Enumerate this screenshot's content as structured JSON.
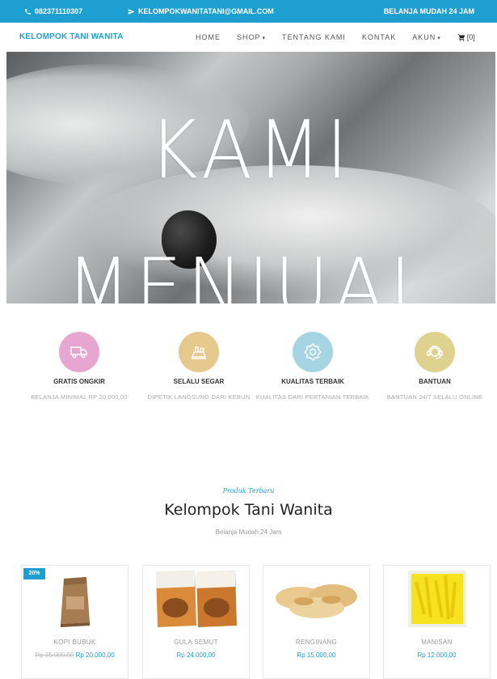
{
  "topbar": {
    "phone": "082371110307",
    "email": "KELOMPOKWANITATANI@GMAIL.COM",
    "slogan": "BELANJA MUDAH 24 JAM",
    "color": "#1e9fd2"
  },
  "navbar": {
    "brand": "KELOMPOK TANI WANITA",
    "items": [
      {
        "label": "HOME"
      },
      {
        "label": "SHOP"
      },
      {
        "label": "TENTANG KAMI"
      },
      {
        "label": "KONTAK"
      },
      {
        "label": "AKUN"
      }
    ],
    "cart_count": "[0]"
  },
  "hero": {
    "line1": "KAMI",
    "line2": "MENJUAL"
  },
  "features": [
    {
      "title": "GRATIS ONGKIR",
      "desc": "BELANJA MINIMAL RP 20.000,00",
      "color": "#e6a6cf",
      "icon": "truck-icon"
    },
    {
      "title": "SELALU SEGAR",
      "desc": "DIPETIK LANGSUNG DARI KEBUN",
      "color": "#e6c98d",
      "icon": "fresh-icon"
    },
    {
      "title": "KUALITAS TERBAIK",
      "desc": "KUALITAS DARI PERTANIAN TERBAIK",
      "color": "#a7d4e3",
      "icon": "quality-icon"
    },
    {
      "title": "BANTUAN",
      "desc": "BANTUAN 24/7 SELALU ONLINE",
      "color": "#dfd28f",
      "icon": "support-icon"
    }
  ],
  "section": {
    "kicker": "Produk Terbaru",
    "heading": "Kelompok Tani Wanita",
    "sub": "Belanja Mudah 24 Jam"
  },
  "products": [
    {
      "name": "KOPI BUBUK",
      "old_price": "Rp 35.000,00",
      "price": "Rp 20.000,00",
      "badge": "20%"
    },
    {
      "name": "GULA SEMUT",
      "price": "Rp 24.000,00"
    },
    {
      "name": "RENGINANG",
      "price": "Rp 15.000,00"
    },
    {
      "name": "MANISAN",
      "price": "Rp 12.000,00"
    }
  ]
}
